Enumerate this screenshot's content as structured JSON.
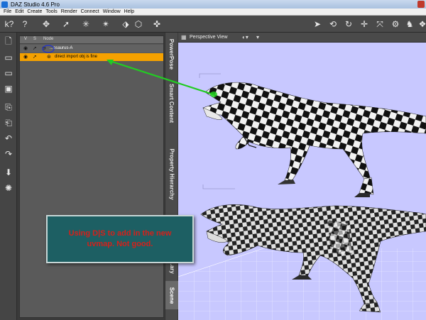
{
  "window": {
    "title": "DAZ Studio 4.6 Pro"
  },
  "menubar": [
    "File",
    "Edit",
    "Create",
    "Tools",
    "Render",
    "Connect",
    "Window",
    "Help"
  ],
  "scene_panel": {
    "columns": {
      "visible": "V",
      "selectable": "S",
      "node": "Node"
    },
    "rows": [
      {
        "label": "...osaurus-A",
        "selected": false
      },
      {
        "label": "direct import obj is fine",
        "selected": true
      }
    ]
  },
  "side_tabs": [
    "PowerPose",
    "Smart Content",
    "Property Hierarchy",
    "...ary",
    "Scene"
  ],
  "viewport": {
    "camera_label": "Perspective View"
  },
  "callout": {
    "text": "Using D|S to add in the new uvmap. Not good."
  },
  "colors": {
    "selection": "#f5a100",
    "callout_bg": "#1d5f63",
    "callout_text": "#d6201a",
    "arrow": "#22cc22",
    "viewport_bg": "#c8c8ff"
  }
}
